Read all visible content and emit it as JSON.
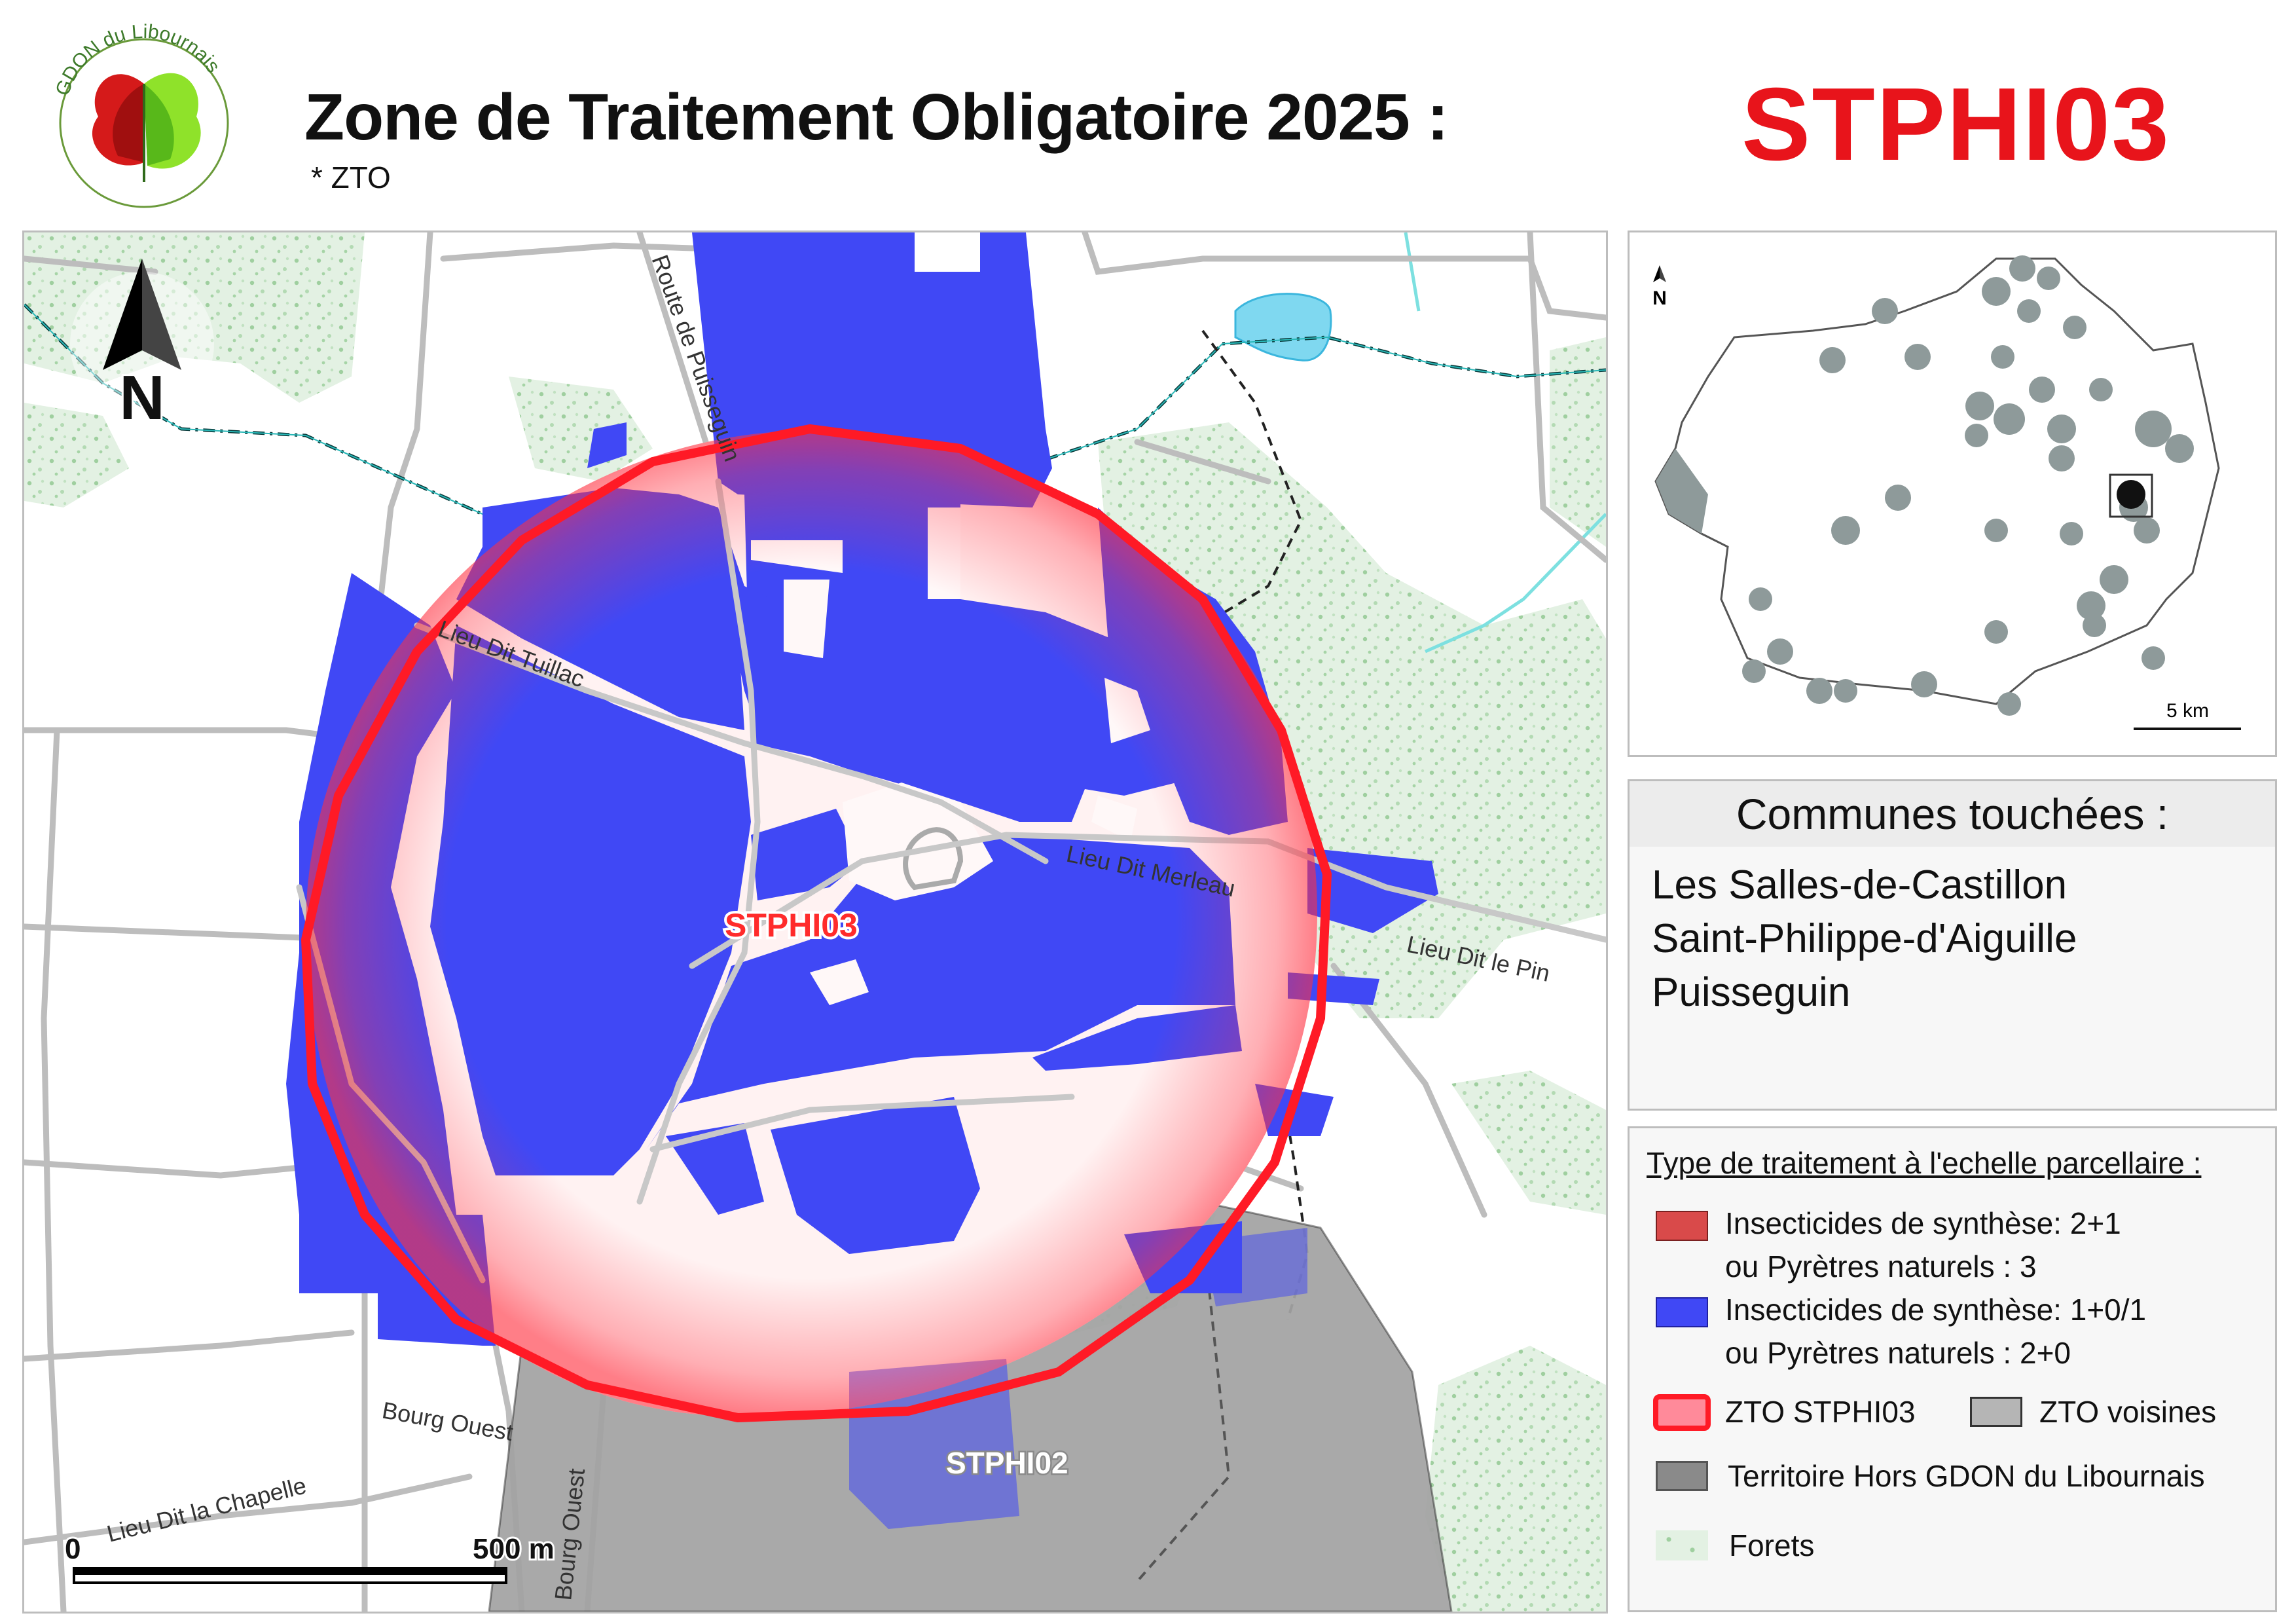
{
  "header": {
    "logo_text": "GDON du Libournais",
    "title": "Zone de Traitement Obligatoire 2025 :",
    "subtitle": "* ZTO",
    "zone_code": "STPHI03"
  },
  "map": {
    "zone_label": "STPHI03",
    "neighbour_label": "STPHI02",
    "north_label": "N",
    "roads": [
      "Route de Puisseguin",
      "Lieu Dit Tuillac",
      "Lieu Dit Merleau",
      "Lieu Dit le Pin",
      "Lieu Dit la Chapelle",
      "Bourg Ouest",
      "Bourg Ouest"
    ],
    "scalebar": {
      "start_label": "0",
      "end_label": "500 m"
    }
  },
  "inset": {
    "north_label": "N",
    "scalebar_label": "5 km"
  },
  "communes": {
    "title": "Communes touchées :",
    "items": [
      "Les Salles-de-Castillon",
      "Saint-Philippe-d'Aiguille",
      "Puisseguin"
    ]
  },
  "legend": {
    "title": "Type de traitement à l'echelle parcellaire :",
    "red_line1": "Insecticides de synthèse: 2+1",
    "red_line2": "ou Pyrètres naturels : 3",
    "blue_line1": "Insecticides de synthèse: 1+0/1",
    "blue_line2": "ou Pyrètres naturels : 2+0",
    "zto_label": "ZTO STPHI03",
    "zto_voisines_label": "ZTO voisines",
    "hors_label": "Territoire Hors GDON du Libournais",
    "forets_label": "Forets"
  },
  "colors": {
    "accent_red": "#e8141b",
    "parcel_blue": "#4048f5",
    "parcel_red": "#d94a4a",
    "neighbour_grey": "#b5b5b5",
    "outside_grey": "#8a8a8a",
    "forest_green": "#cfe6cf"
  }
}
